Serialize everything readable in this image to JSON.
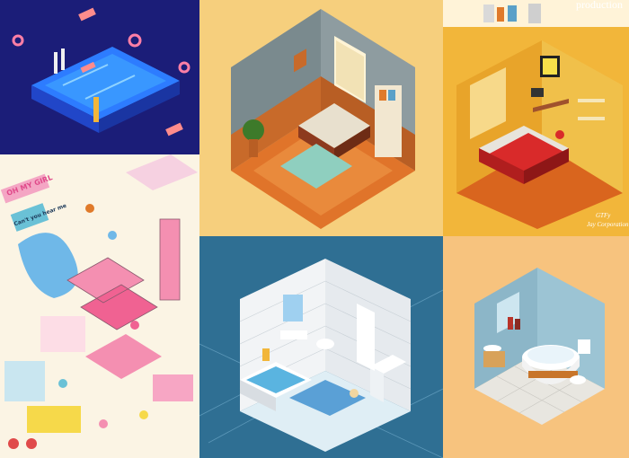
{
  "collage": {
    "tiles": [
      {
        "id": "pool-tile",
        "bg": "#1a1f7a"
      },
      {
        "id": "pixel-bedroom-tile",
        "bg": "#f6cf7d"
      },
      {
        "id": "yellow-room-tile",
        "bg": "#f2b63a"
      },
      {
        "id": "illustrated-city-tile",
        "bg": "#fbf4e4"
      },
      {
        "id": "blueprint-bathroom-tile",
        "bg": "#2f6f93"
      },
      {
        "id": "small-bathroom-tile",
        "bg": "#f7c37e"
      }
    ]
  },
  "texts": {
    "production": "production",
    "sign_ohmygirl": "OH MY GIRL",
    "sign_cant_you": "Can't you hear me",
    "signature_1": "GTFy",
    "signature_2": "Jay Corporation"
  },
  "colors": {
    "accent_red": "#d92a2a",
    "accent_orange": "#e07a2a",
    "blueprint_blue": "#2f6f93"
  }
}
